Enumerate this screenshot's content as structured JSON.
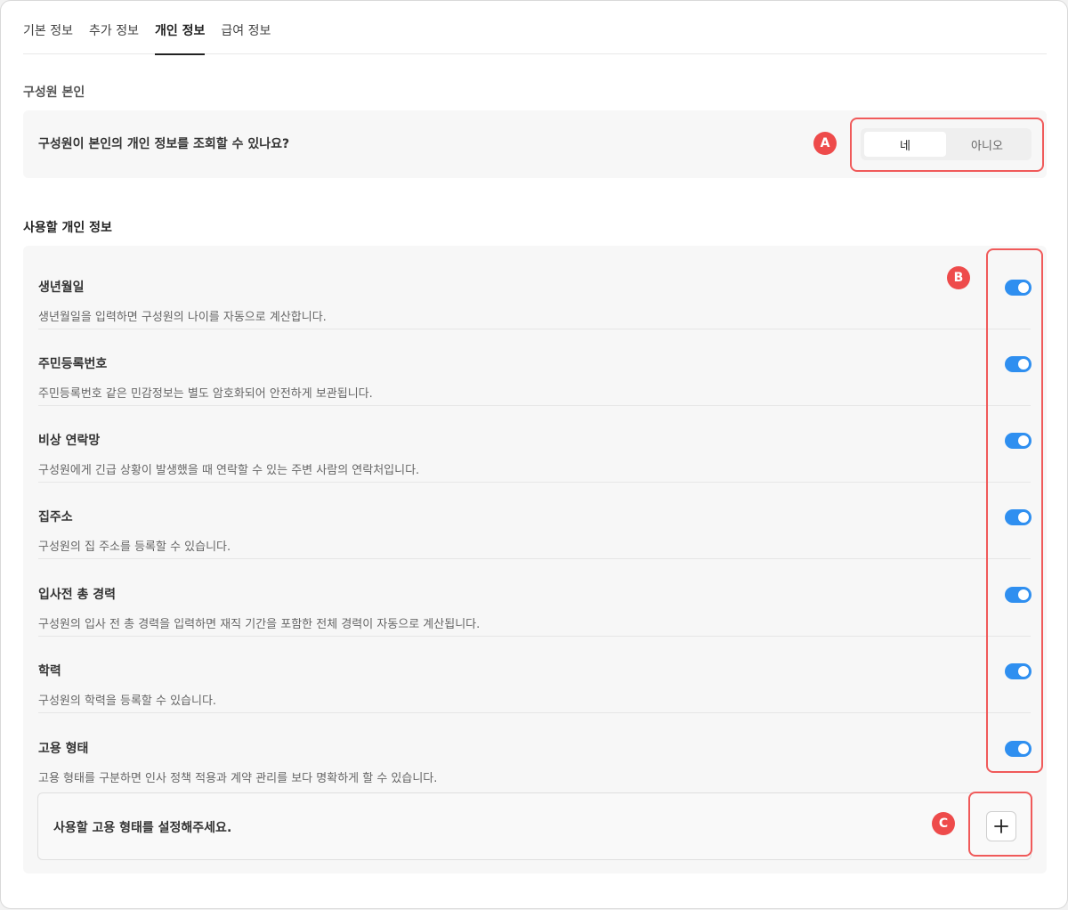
{
  "tabs": [
    "기본 정보",
    "추가 정보",
    "개인 정보",
    "급여 정보"
  ],
  "active_tab_index": 2,
  "self_section": {
    "title": "구성원 본인",
    "question": "구성원이 본인의 개인 정보를 조회할 수 있나요?",
    "options": [
      "네",
      "아니오"
    ],
    "selected": "네"
  },
  "fields_section": {
    "title": "사용할 개인 정보",
    "items": [
      {
        "title": "생년월일",
        "desc": "생년월일을 입력하면 구성원의 나이를 자동으로 계산합니다.",
        "enabled": true
      },
      {
        "title": "주민등록번호",
        "desc": "주민등록번호 같은 민감정보는 별도 암호화되어 안전하게 보관됩니다.",
        "enabled": true
      },
      {
        "title": "비상 연락망",
        "desc": "구성원에게 긴급 상황이 발생했을 때 연락할 수 있는 주변 사람의 연락처입니다.",
        "enabled": true
      },
      {
        "title": "집주소",
        "desc": "구성원의 집 주소를 등록할 수 있습니다.",
        "enabled": true
      },
      {
        "title": "입사전 총 경력",
        "desc": "구성원의 입사 전 총 경력을 입력하면 재직 기간을 포함한 전체 경력이 자동으로 계산됩니다.",
        "enabled": true
      },
      {
        "title": "학력",
        "desc": "구성원의 학력을 등록할 수 있습니다.",
        "enabled": true
      },
      {
        "title": "고용 형태",
        "desc": "고용 형태를 구분하면 인사 정책 적용과 계약 관리를 보다 명확하게 할 수 있습니다.",
        "enabled": true
      }
    ],
    "employment_type_prompt": "사용할 고용 형태를 설정해주세요."
  },
  "annotations": [
    "A",
    "B",
    "C"
  ],
  "colors": {
    "toggle_on": "#2f8ff0",
    "annotation_red": "#ee4b4b"
  },
  "icons": {
    "add": "plus-icon"
  }
}
